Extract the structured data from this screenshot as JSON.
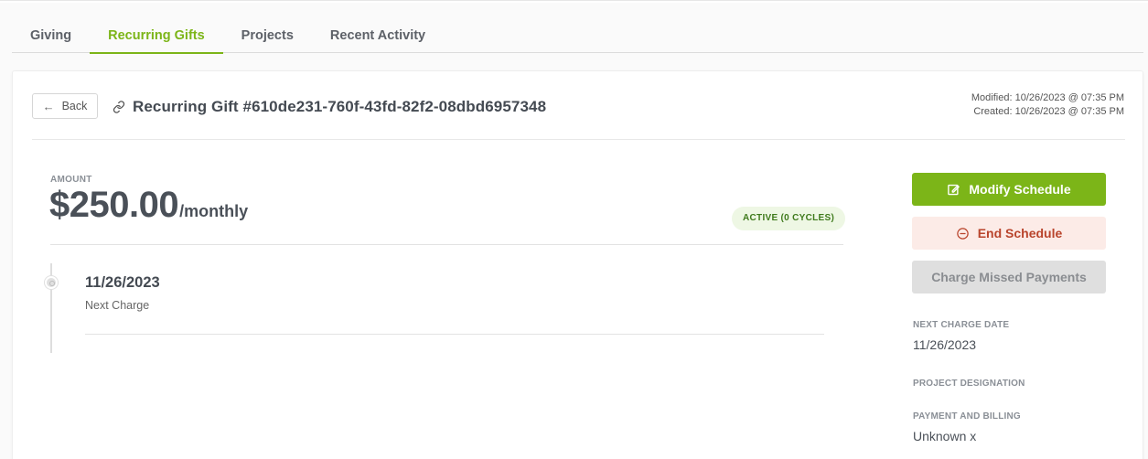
{
  "tabs": [
    {
      "label": "Giving"
    },
    {
      "label": "Recurring Gifts"
    },
    {
      "label": "Projects"
    },
    {
      "label": "Recent Activity"
    }
  ],
  "header": {
    "back_label": "Back",
    "title": "Recurring Gift #610de231-760f-43fd-82f2-08dbd6957348",
    "modified": "Modified: 10/26/2023 @ 07:35 PM",
    "created": "Created: 10/26/2023 @ 07:35 PM"
  },
  "gift": {
    "amount_label": "AMOUNT",
    "amount": "$250.00",
    "frequency": "/monthly",
    "status": "ACTIVE (0 CYCLES)"
  },
  "timeline": {
    "date": "11/26/2023",
    "label": "Next Charge"
  },
  "actions": {
    "modify": "Modify Schedule",
    "end": "End Schedule",
    "missed": "Charge Missed Payments"
  },
  "details": {
    "next_charge_label": "NEXT CHARGE DATE",
    "next_charge_value": "11/26/2023",
    "project_label": "PROJECT DESIGNATION",
    "payment_label": "PAYMENT AND BILLING",
    "payment_value": "Unknown x"
  },
  "colors": {
    "accent": "#7cb518",
    "danger_bg": "#fcebe7",
    "danger_text": "#b9442c",
    "badge_bg": "#eef7e4",
    "disabled_bg": "#dfdfdf"
  }
}
